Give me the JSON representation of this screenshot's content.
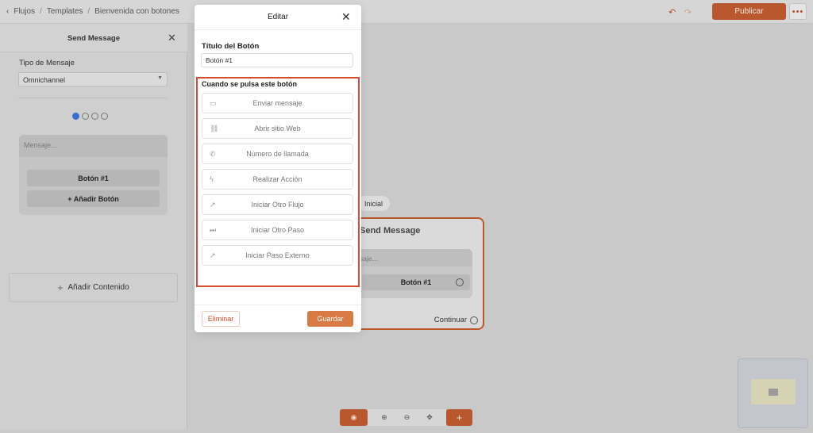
{
  "breadcrumb": {
    "root": "Flujos",
    "section": "Templates",
    "current": "Bienvenida con botones"
  },
  "toolbar": {
    "publish_label": "Publicar",
    "more_label": "•••"
  },
  "left_panel": {
    "title": "Send Message",
    "type_label": "Tipo de Mensaje",
    "type_value": "Omnichannel",
    "message_placeholder": "Mensaje...",
    "button_label": "Botón #1",
    "add_button_label": "+ Añadir Botón",
    "add_content_label": "Añadir Contenido"
  },
  "canvas": {
    "start_tag": "Inicial",
    "node_title": "Send Message",
    "node_placeholder": "saje...",
    "node_button": "Botón #1",
    "continue_label": "Continuar"
  },
  "modal": {
    "title": "Editar",
    "button_title_label": "Título del Botón",
    "button_title_value": "Botón #1",
    "action_label": "Cuando se pulsa este botón",
    "options": [
      {
        "label": "Enviar mensaje",
        "icon": "chat-icon"
      },
      {
        "label": "Abrir sitio Web",
        "icon": "link-icon"
      },
      {
        "label": "Número de llamada",
        "icon": "phone-icon"
      },
      {
        "label": "Realizar Acción",
        "icon": "bolt-icon"
      },
      {
        "label": "Iniciar Otro Flujo",
        "icon": "external-link-icon"
      },
      {
        "label": "Iniciar Otro Paso",
        "icon": "skip-icon"
      },
      {
        "label": "Iniciar Paso Externo",
        "icon": "external-link-icon"
      }
    ],
    "delete_label": "Eliminar",
    "save_label": "Guardar"
  },
  "colors": {
    "accent": "#d97a45",
    "highlight": "#d94a32",
    "danger": "#d24a2e"
  }
}
